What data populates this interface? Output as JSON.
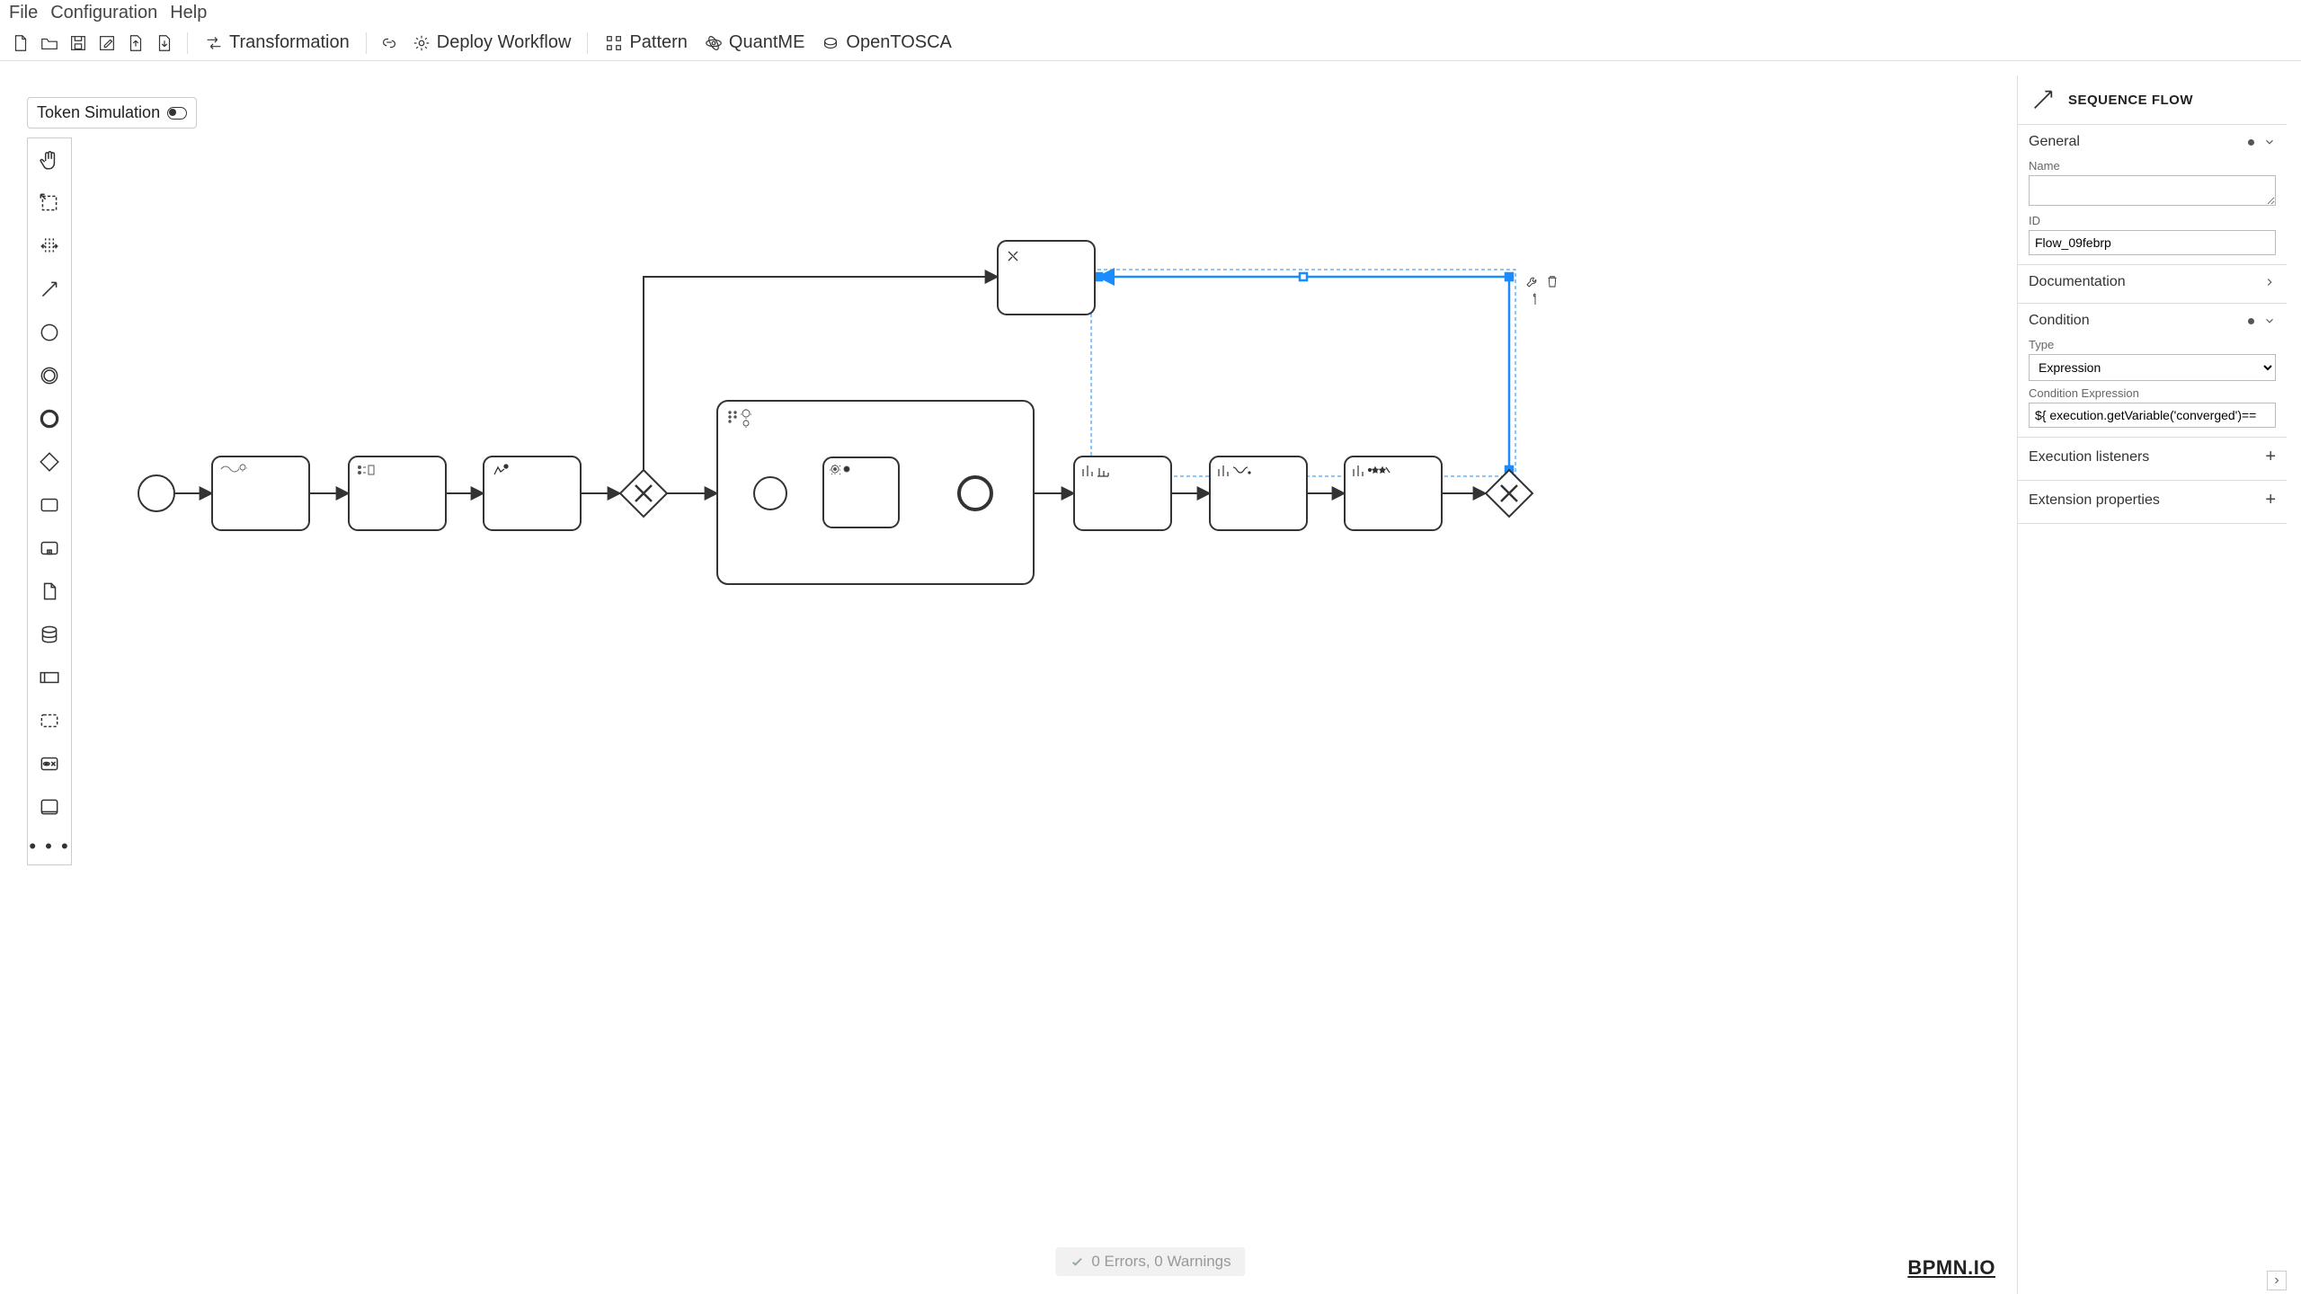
{
  "menu": {
    "file": "File",
    "config": "Configuration",
    "help": "Help"
  },
  "toolbar": {
    "transformation": "Transformation",
    "deploy": "Deploy Workflow",
    "pattern": "Pattern",
    "quantme": "QuantME",
    "opentosca": "OpenTOSCA"
  },
  "tokenSim": "Token Simulation",
  "palette": {
    "more": "• • •"
  },
  "status": {
    "text": "0 Errors, 0 Warnings"
  },
  "logo": "BPMN.IO",
  "props": {
    "title": "SEQUENCE FLOW",
    "general": {
      "label": "General",
      "nameLabel": "Name",
      "nameValue": "",
      "idLabel": "ID",
      "idValue": "Flow_09febrp"
    },
    "documentation": {
      "label": "Documentation"
    },
    "condition": {
      "label": "Condition",
      "typeLabel": "Type",
      "typeValue": "Expression",
      "exprLabel": "Condition Expression",
      "exprValue": "${ execution.getVariable('converged')=="
    },
    "execListeners": {
      "label": "Execution listeners"
    },
    "extProps": {
      "label": "Extension properties"
    }
  },
  "diagram": {
    "selectedFlowId": "Flow_09febrp"
  }
}
